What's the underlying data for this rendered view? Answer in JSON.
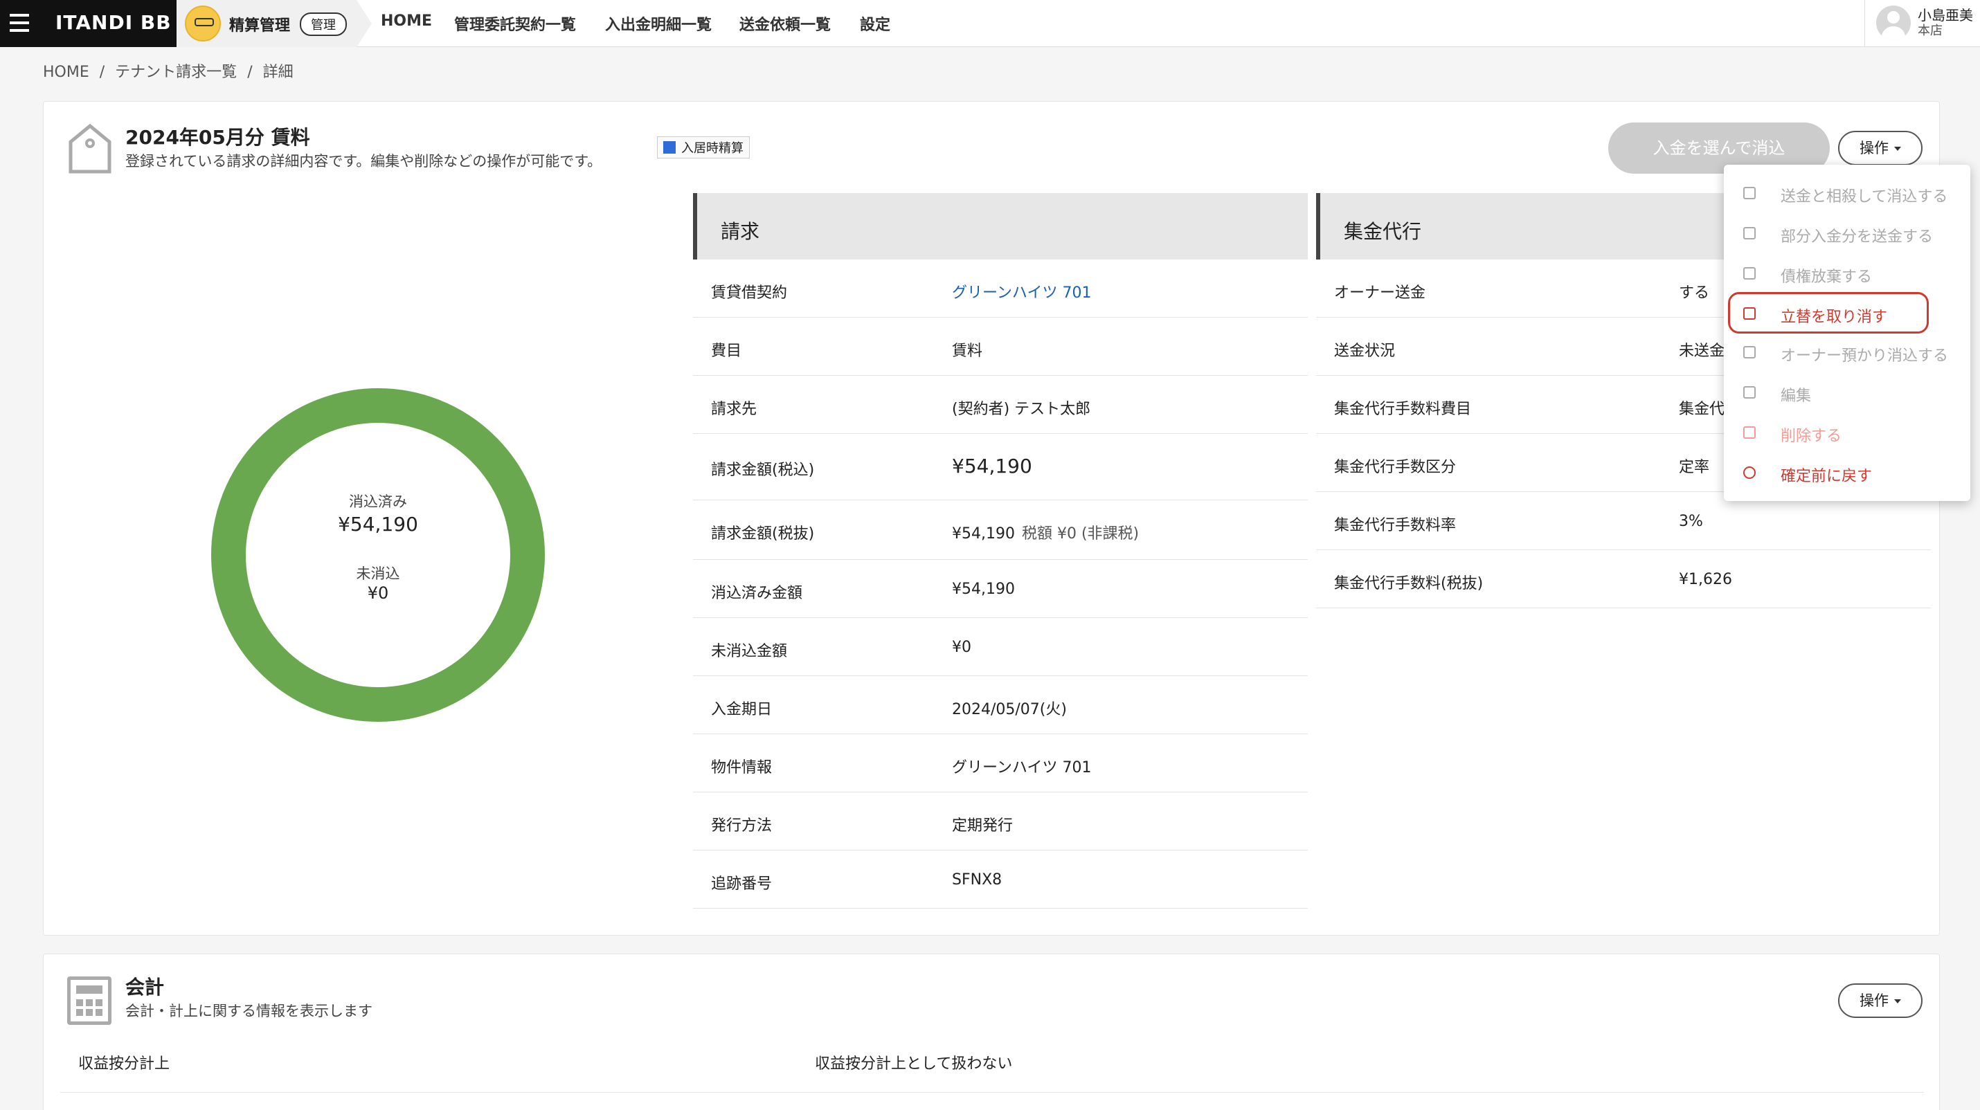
{
  "nav": {
    "brand": "ITANDI BB",
    "module_label": "精算管理",
    "module_badge": "管理",
    "items": [
      "HOME",
      "管理委託契約一覧",
      "入出金明細一覧",
      "送金依頼一覧",
      "設定"
    ],
    "user_name": "小島亜美",
    "user_branch": "本店"
  },
  "breadcrumb": [
    "HOME",
    "/",
    "テナント請求一覧",
    "/",
    "詳細"
  ],
  "header": {
    "title": "2024年05月分 賃料",
    "subtitle": "登録されている請求の詳細内容です。編集や削除などの操作が可能です。",
    "badge": "入居時精算",
    "allocate_button": "入金を選んで消込",
    "operation_button": "操作"
  },
  "donut": {
    "allocated_label": "消込済み",
    "allocated_value": "¥54,190",
    "unallocated_label": "未消込",
    "unallocated_value": "¥0",
    "color": "#6aa84f"
  },
  "billing": {
    "title": "請求",
    "rows": [
      {
        "label": "賃貸借契約",
        "value": "グリーンハイツ 701"
      },
      {
        "label": "費目",
        "value": "賃料"
      },
      {
        "label": "請求先",
        "value": "(契約者) テスト太郎"
      },
      {
        "label": "請求金額(税込)",
        "value": "¥54,190"
      },
      {
        "label": "請求金額(税抜)",
        "value": "¥54,190",
        "note": "税額 ¥0 (非課税)"
      },
      {
        "label": "消込済み金額",
        "value": "¥54,190"
      },
      {
        "label": "未消込金額",
        "value": "¥0"
      },
      {
        "label": "入金期日",
        "value": "2024/05/07(火)"
      },
      {
        "label": "物件情報",
        "value": "グリーンハイツ 701"
      },
      {
        "label": "発行方法",
        "value": "定期発行"
      },
      {
        "label": "追跡番号",
        "value": "SFNX8"
      }
    ]
  },
  "collection": {
    "title": "集金代行",
    "rows": [
      {
        "label": "オーナー送金",
        "value": "する"
      },
      {
        "label": "送金状況",
        "value": "未送金"
      },
      {
        "label": "集金代行手数料費目",
        "value": "集金代"
      },
      {
        "label": "集金代行手数区分",
        "value": "定率"
      },
      {
        "label": "集金代行手数料率",
        "value": "3%"
      },
      {
        "label": "集金代行手数料(税抜)",
        "value": "¥1,626"
      }
    ]
  },
  "menu": {
    "items": [
      {
        "label": "送金と相殺して消込する",
        "state": "disabled",
        "icon": "copy-icon"
      },
      {
        "label": "部分入金分を送金する",
        "state": "disabled",
        "icon": "plus-square-icon"
      },
      {
        "label": "債権放棄する",
        "state": "disabled",
        "icon": "minus-square-icon"
      },
      {
        "label": "立替を取り消す",
        "state": "active",
        "icon": "cancel-advance-icon"
      },
      {
        "label": "オーナー預かり消込する",
        "state": "disabled",
        "icon": "document-icon"
      },
      {
        "label": "編集",
        "state": "disabled",
        "icon": "pencil-icon"
      },
      {
        "label": "削除する",
        "state": "danger-disabled",
        "icon": "trash-icon"
      },
      {
        "label": "確定前に戻す",
        "state": "active",
        "icon": "undo-icon"
      }
    ]
  },
  "accounting": {
    "title": "会計",
    "subtitle": "会計・計上に関する情報を表示します",
    "operation_button": "操作",
    "row_label": "収益按分計上",
    "row_value": "収益按分計上として扱わない"
  }
}
